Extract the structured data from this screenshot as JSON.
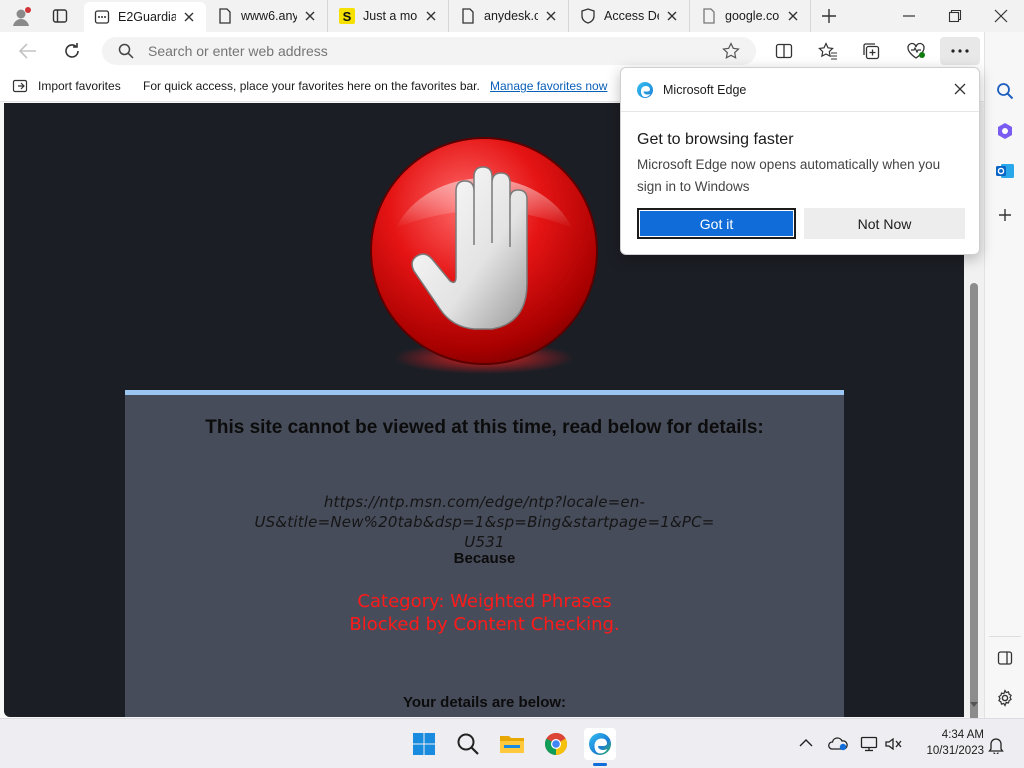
{
  "tabs": [
    {
      "title": "E2Guardian",
      "active": true
    },
    {
      "title": "www6.any"
    },
    {
      "title": "Just a mo"
    },
    {
      "title": "anydesk.co"
    },
    {
      "title": "Access De"
    },
    {
      "title": "google.co"
    }
  ],
  "address": {
    "placeholder": "Search or enter web address"
  },
  "favorites_bar": {
    "import_label": "Import favorites",
    "hint": "For quick access, place your favorites here on the favorites bar.",
    "manage_link": "Manage favorites now"
  },
  "page": {
    "title": "This site cannot be viewed at this time, read below for details:",
    "url_line1": "https://ntp.msn.com/edge/ntp?locale=en-US&title=New%20tab&dsp=1&sp=Bing&startpage=1&PC=",
    "url_line2": "U531",
    "because": "Because",
    "category": "Category: Weighted Phrases",
    "detail": "Blocked by Content Checking.",
    "details_label": "Your details are below:"
  },
  "popup": {
    "app_name": "Microsoft Edge",
    "heading": "Get to browsing faster",
    "body": "Microsoft Edge now opens automatically when you sign in to Windows",
    "primary": "Got it",
    "secondary": "Not Now"
  },
  "clock": {
    "time": "4:34 AM",
    "date": "10/31/2023"
  },
  "colors": {
    "accent": "#0f6cd8",
    "blocked_red": "#ff1a1a",
    "page_bg": "#1c1e25",
    "panel_bg": "#474c5a"
  }
}
